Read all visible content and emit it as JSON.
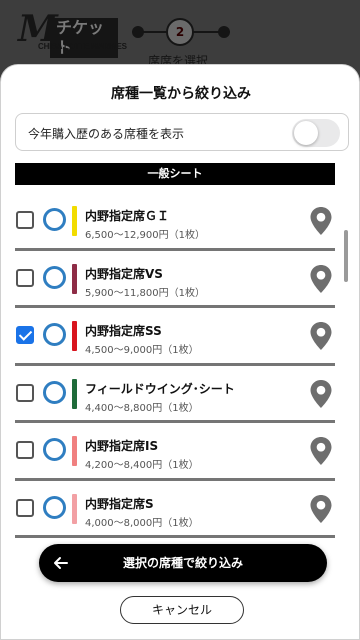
{
  "header": {
    "logo_mark": "M",
    "logo_text": "チケット",
    "logo_sub": "CHIBA LOTTE MARINES",
    "step_number": "2",
    "step_label": "席席を選択"
  },
  "sheet": {
    "title": "席種一覧から絞り込み",
    "toggle": {
      "label": "今年購入歴のある席種を表示",
      "on": false
    },
    "section": "一般シート",
    "items": [
      {
        "name": "内野指定席ＧＩ",
        "price": "6,500〜12,900円（1枚）",
        "checked": false,
        "color": "#f2dc00"
      },
      {
        "name": "内野指定席VS",
        "price": "5,900〜11,800円（1枚）",
        "checked": false,
        "color": "#8e2c46"
      },
      {
        "name": "内野指定席SS",
        "price": "4,500〜9,000円（1枚）",
        "checked": true,
        "color": "#d8141e"
      },
      {
        "name": "フィールドウイング･シート",
        "price": "4,400〜8,800円（1枚）",
        "checked": false,
        "color": "#1f6b3a"
      },
      {
        "name": "内野指定席IS",
        "price": "4,200〜8,400円（1枚）",
        "checked": false,
        "color": "#f08080"
      },
      {
        "name": "内野指定席S",
        "price": "4,000〜8,000円（1枚）",
        "checked": false,
        "color": "#f2a0a4"
      }
    ],
    "filter_button": "選択の席種で絞り込み",
    "cancel_button": "キャンセル"
  },
  "colors": {
    "accent": "#1a73e8",
    "availability": "#2f7ec1",
    "pin": "#6e6e6e"
  },
  "icons": {
    "availability": "circle-icon",
    "location": "map-pin-icon",
    "back": "arrow-left-icon"
  }
}
